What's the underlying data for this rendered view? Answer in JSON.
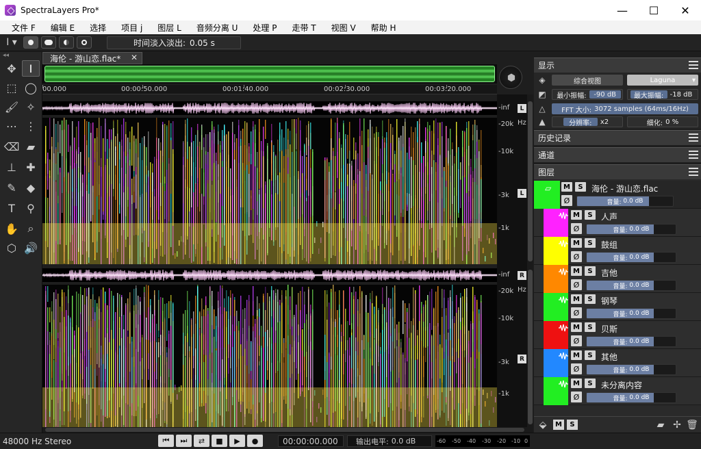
{
  "window": {
    "title": "SpectraLayers Pro*",
    "min": "—",
    "max": "☐",
    "close": "✕"
  },
  "menu": [
    "文件 F",
    "编辑 E",
    "选择",
    "项目 j",
    "图层 L",
    "音频分离 U",
    "处理 P",
    "走带 T",
    "视图 V",
    "帮助 H"
  ],
  "toolopts": {
    "fade_label": "时间淡入淡出:",
    "fade_value": "0.05 s"
  },
  "tab": {
    "label": "海伦 - 游山恋.flac*",
    "close": "✕"
  },
  "ruler": {
    "labels": [
      "00.000",
      "00:00:50.000",
      "00:01:40.000",
      "00:02:30.000",
      "00:03:20.000"
    ]
  },
  "scale": {
    "inf": "-inf",
    "hz": "Hz",
    "ticks": [
      "-20k",
      "-10k",
      "-3k",
      "-1k"
    ],
    "left": "L",
    "right": "R"
  },
  "status": {
    "format": "48000 Hz Stereo",
    "timecode": "00:00:00.000",
    "out_label": "输出电平:",
    "out_value": "0.0 dB",
    "meter_ticks": [
      "-60",
      "-50",
      "-40",
      "-30",
      "-20",
      "-10",
      "0"
    ]
  },
  "transport": [
    "⏮",
    "⏭",
    "⇄",
    "■",
    "▶",
    "●"
  ],
  "display": {
    "title": "显示",
    "view_label": "综合视图",
    "colormap": "Laguna",
    "min_label": "最小振幅:",
    "min_value": "-90 dB",
    "max_label": "最大振幅:",
    "max_value": "-18 dB",
    "fft_label": "FFT 大小:",
    "fft_value": "3072 samples (64ms/16Hz)",
    "res_label": "分辨率:",
    "res_value": "x2",
    "refine_label": "细化:",
    "refine_value": "0 %"
  },
  "panels": {
    "history": "历史记录",
    "channels": "通道",
    "layers": "图层"
  },
  "layers": [
    {
      "name": "海伦 - 游山恋.flac",
      "color": "#22ee22",
      "vol_label": "音量:",
      "vol": "0.0 dB",
      "level": 0.75
    },
    {
      "name": "人声",
      "color": "#ff22ff",
      "vol_label": "音量:",
      "vol": "0.0 dB",
      "level": 0.75
    },
    {
      "name": "鼓组",
      "color": "#ffff00",
      "vol_label": "音量:",
      "vol": "0.0 dB",
      "level": 0.75
    },
    {
      "name": "吉他",
      "color": "#ff8800",
      "vol_label": "音量:",
      "vol": "0.0 dB",
      "level": 0.75
    },
    {
      "name": "钢琴",
      "color": "#22ee22",
      "vol_label": "音量:",
      "vol": "0.0 dB",
      "level": 0.75
    },
    {
      "name": "贝斯",
      "color": "#ee1111",
      "vol_label": "音量:",
      "vol": "0.0 dB",
      "level": 0.75
    },
    {
      "name": "其他",
      "color": "#2288ff",
      "vol_label": "音量:",
      "vol": "0.0 dB",
      "level": 0.75
    },
    {
      "name": "未分离内容",
      "color": "#22ee22",
      "vol_label": "音量:",
      "vol": "0.0 dB",
      "level": 0.75
    }
  ],
  "ms": {
    "m": "M",
    "s": "S",
    "phase": "Ø"
  }
}
